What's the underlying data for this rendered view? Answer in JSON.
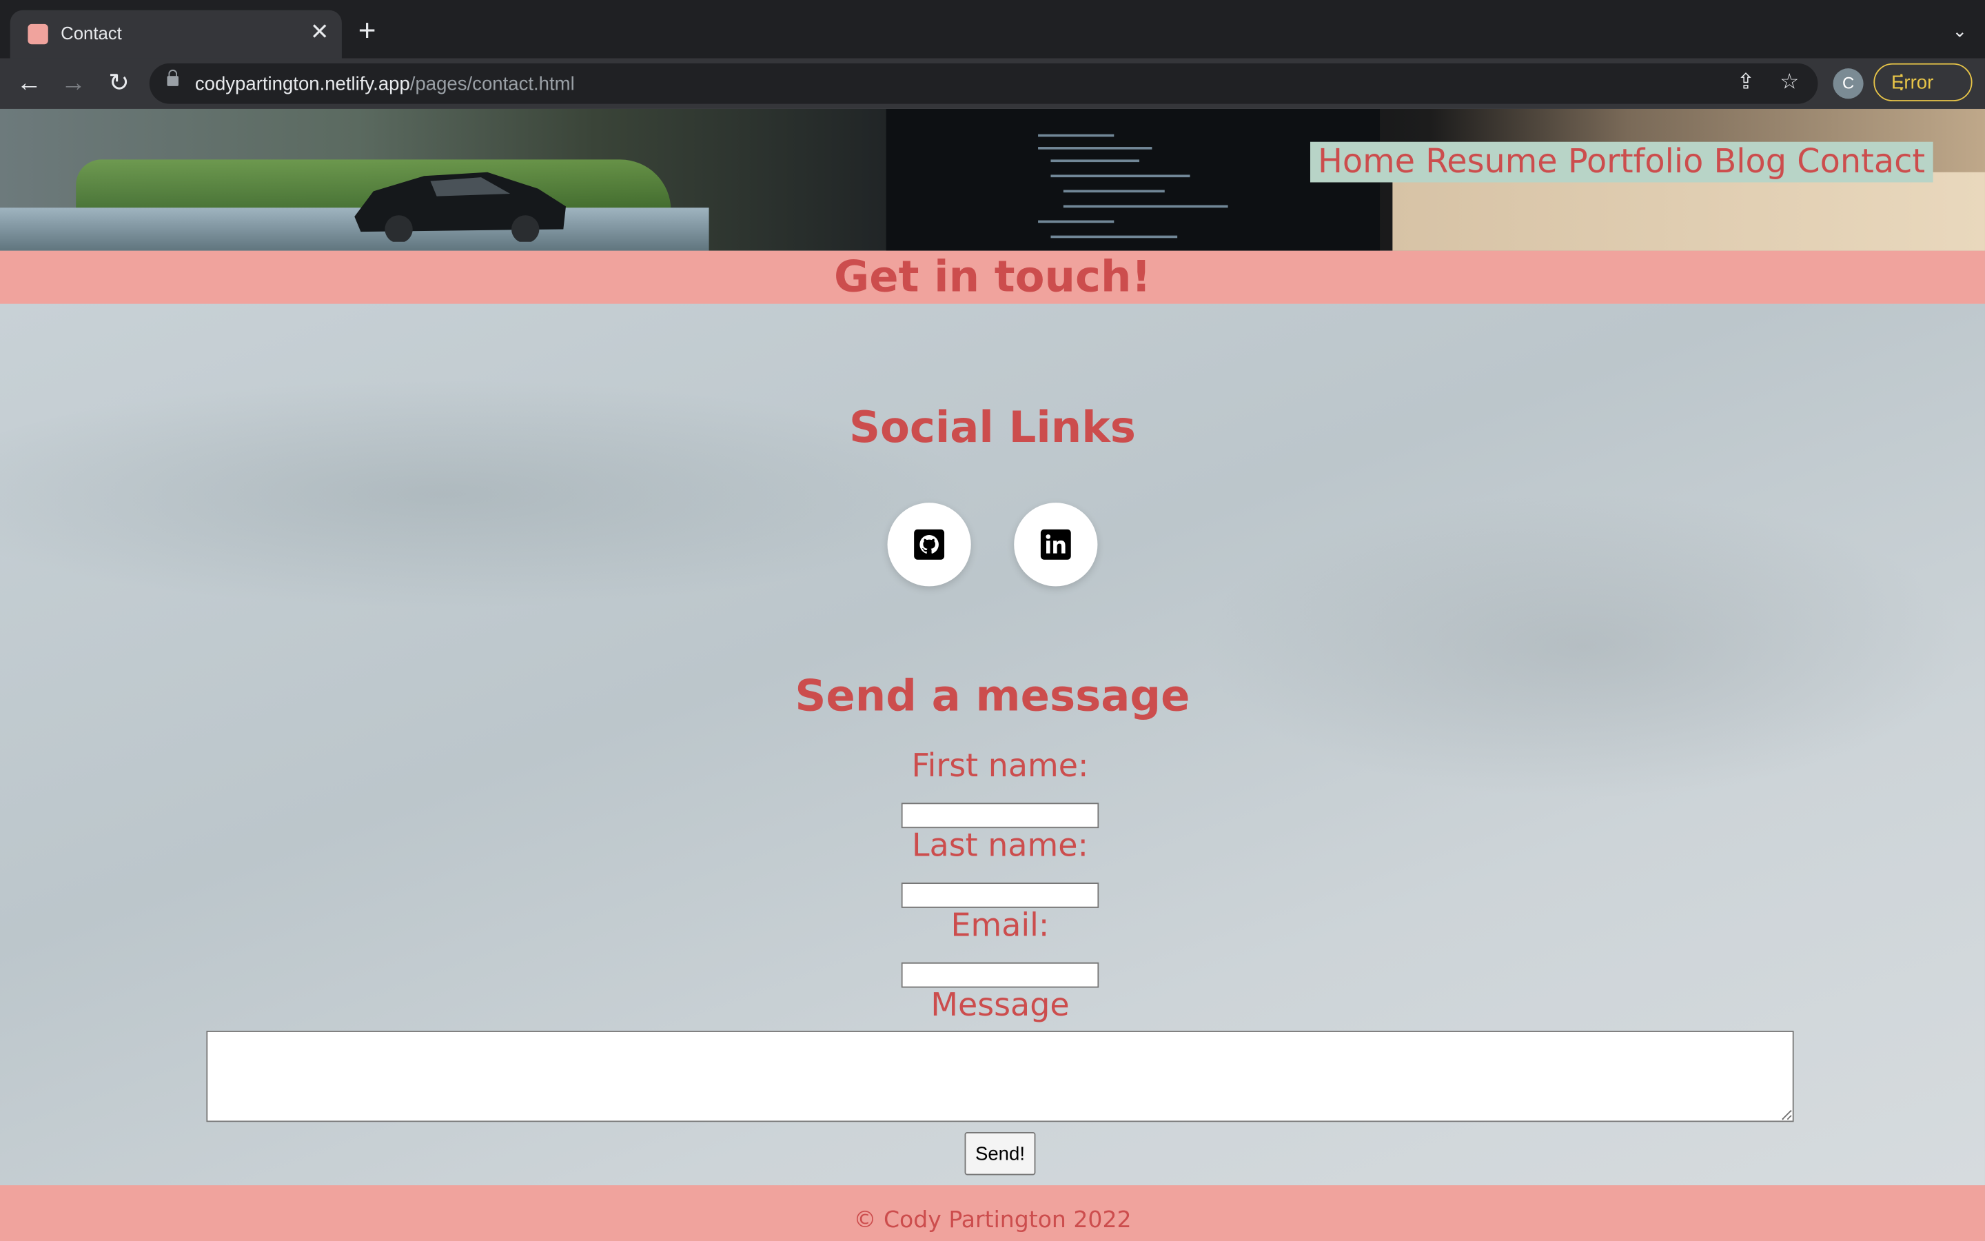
{
  "browser": {
    "tab_title": "Contact",
    "tab_close": "✕",
    "new_tab": "+",
    "tab_menu": "⌄",
    "url_host": "codypartington.netlify.app",
    "url_path": "/pages/contact.html",
    "profile_initial": "C",
    "error_label": "Error",
    "icons": [
      "back-icon",
      "forward-icon",
      "reload-icon",
      "lock-icon",
      "share-icon",
      "star-icon",
      "more-icon"
    ]
  },
  "nav": {
    "items": [
      "Home",
      "Resume",
      "Portfolio",
      "Blog",
      "Contact"
    ]
  },
  "banner": {
    "title": "Get in touch!"
  },
  "social": {
    "title": "Social Links",
    "links": [
      {
        "name": "GitHub",
        "icon": "github-icon"
      },
      {
        "name": "LinkedIn",
        "icon": "linkedin-icon"
      }
    ]
  },
  "form": {
    "title": "Send a message",
    "first_name_label": "First name:",
    "first_name_value": "",
    "last_name_label": "Last name:",
    "last_name_value": "",
    "email_label": "Email:",
    "email_value": "",
    "message_label": "Message",
    "message_value": "",
    "submit_label": "Send!"
  },
  "footer": {
    "text": "© Cody Partington 2022"
  },
  "colors": {
    "accent_text": "#cc4d4d",
    "banner_bg": "#f0a39d",
    "nav_bg": "#b8d4c7"
  }
}
